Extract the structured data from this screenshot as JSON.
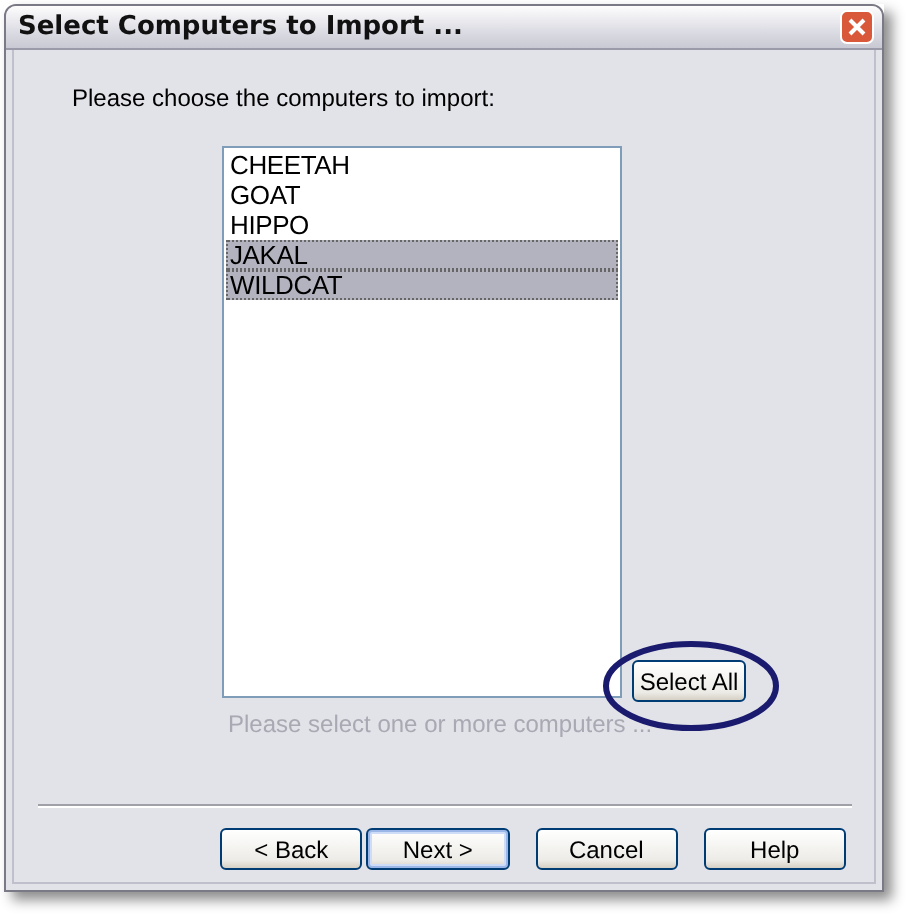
{
  "window": {
    "title": "Select Computers to Import ..."
  },
  "prompt": "Please choose the computers to import:",
  "computers": [
    {
      "name": "CHEETAH",
      "selected": false
    },
    {
      "name": "GOAT",
      "selected": false
    },
    {
      "name": "HIPPO",
      "selected": false
    },
    {
      "name": "JAKAL",
      "selected": true
    },
    {
      "name": "WILDCAT",
      "selected": true
    }
  ],
  "select_all": {
    "label": "Select All",
    "highlighted": true
  },
  "hint": "Please select one or more computers ...",
  "buttons": [
    {
      "label": "< Back",
      "default": false
    },
    {
      "label": "Next >",
      "default": true
    },
    {
      "label": "Cancel",
      "default": false
    },
    {
      "label": "Help",
      "default": false
    }
  ]
}
